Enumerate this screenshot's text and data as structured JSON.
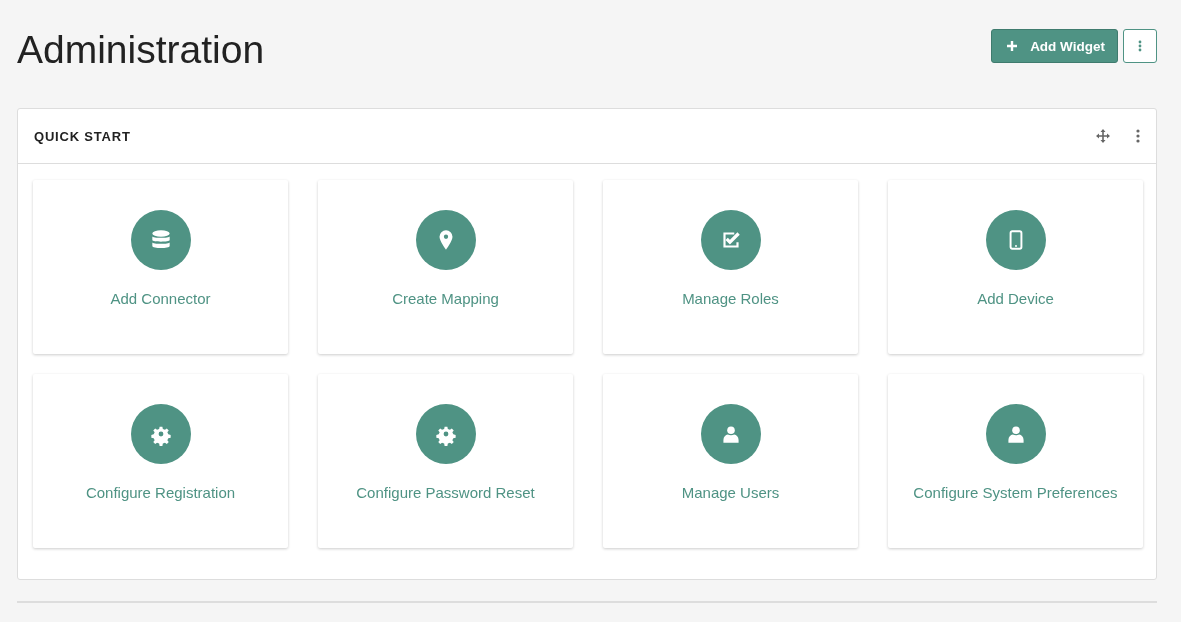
{
  "page": {
    "title": "Administration"
  },
  "toolbar": {
    "add_button": {
      "label": "Add Widget"
    }
  },
  "widget": {
    "title": "QUICK START",
    "items": [
      {
        "label": "Add Connector",
        "kind": "database"
      },
      {
        "label": "Create Mapping",
        "kind": "pin"
      },
      {
        "label": "Manage Roles",
        "kind": "checkbox"
      },
      {
        "label": "Add Device",
        "kind": "tablet"
      },
      {
        "label": "Configure Registration",
        "kind": "gear"
      },
      {
        "label": "Configure Password Reset",
        "kind": "gear"
      },
      {
        "label": "Manage Users",
        "kind": "user"
      },
      {
        "label": "Configure System Preferences",
        "kind": "user"
      }
    ]
  }
}
